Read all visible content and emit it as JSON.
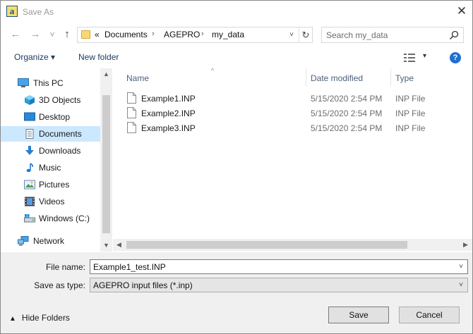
{
  "window": {
    "app_icon_letter": "a",
    "title": "Save As",
    "close_glyph": "✕"
  },
  "nav": {
    "back_glyph": "←",
    "forward_glyph": "→",
    "recent_glyph": "˅",
    "up_glyph": "↑"
  },
  "address": {
    "overflow": "«",
    "crumbs": [
      "Documents",
      "AGEPRO",
      "my_data"
    ],
    "separator": "›",
    "dropdown_glyph": "˅",
    "refresh_glyph": "↻"
  },
  "search": {
    "placeholder": "Search my_data",
    "value": ""
  },
  "toolbar": {
    "organize_label": "Organize ▾",
    "new_folder_label": "New folder",
    "view_drop_glyph": "▾",
    "help_glyph": "?"
  },
  "nav_pane": {
    "items": [
      {
        "label": "This PC",
        "icon": "pc-icon"
      },
      {
        "label": "3D Objects",
        "icon": "3d-objects-icon"
      },
      {
        "label": "Desktop",
        "icon": "desktop-icon"
      },
      {
        "label": "Documents",
        "icon": "documents-icon",
        "selected": true
      },
      {
        "label": "Downloads",
        "icon": "downloads-icon"
      },
      {
        "label": "Music",
        "icon": "music-icon"
      },
      {
        "label": "Pictures",
        "icon": "pictures-icon"
      },
      {
        "label": "Videos",
        "icon": "videos-icon"
      },
      {
        "label": "Windows (C:)",
        "icon": "drive-icon"
      },
      {
        "label": "Network",
        "icon": "network-icon"
      }
    ]
  },
  "file_list": {
    "columns": [
      "Name",
      "Date modified",
      "Type"
    ],
    "sort_caret": "^",
    "files": [
      {
        "name": "Example1.INP",
        "date": "5/15/2020 2:54 PM",
        "type": "INP File"
      },
      {
        "name": "Example2.INP",
        "date": "5/15/2020 2:54 PM",
        "type": "INP File"
      },
      {
        "name": "Example3.INP",
        "date": "5/15/2020 2:54 PM",
        "type": "INP File"
      }
    ]
  },
  "bottom": {
    "filename_label": "File name:",
    "filename_value": "Example1_test.INP",
    "type_label": "Save as type:",
    "type_value": "AGEPRO input files (*.inp)",
    "hide_folders_label": "Hide Folders",
    "save_label": "Save",
    "cancel_label": "Cancel"
  },
  "colors": {
    "selected_bg": "#cce8ff",
    "accent": "#1f6fd1",
    "footer_bg": "#f0f0f0"
  }
}
